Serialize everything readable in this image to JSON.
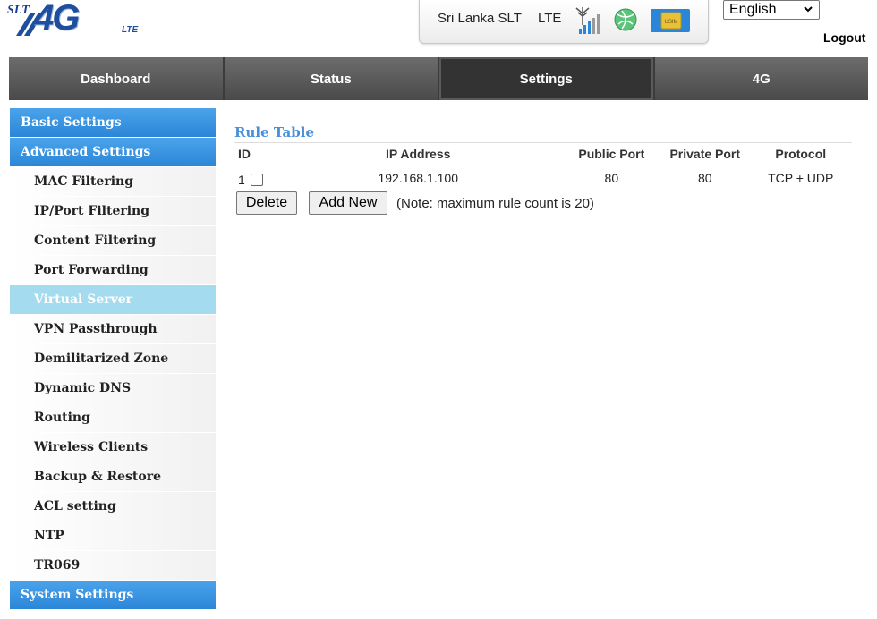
{
  "header": {
    "logo": {
      "brand": "SLT",
      "product": "4G",
      "suffix": "LTE"
    },
    "status": {
      "operator": "Sri Lanka SLT",
      "network_type": "LTE",
      "sim_label": "USIM"
    },
    "language": {
      "selected": "English"
    },
    "logout_label": "Logout"
  },
  "topnav": {
    "tabs": [
      {
        "label": "Dashboard"
      },
      {
        "label": "Status"
      },
      {
        "label": "Settings"
      },
      {
        "label": "4G"
      }
    ],
    "active_index": 2
  },
  "sidebar": {
    "basic_settings": "Basic Settings",
    "advanced_settings": "Advanced Settings",
    "items": [
      {
        "label": "MAC Filtering"
      },
      {
        "label": "IP/Port Filtering"
      },
      {
        "label": "Content Filtering"
      },
      {
        "label": "Port Forwarding"
      },
      {
        "label": "Virtual Server"
      },
      {
        "label": "VPN Passthrough"
      },
      {
        "label": "Demilitarized Zone"
      },
      {
        "label": "Dynamic DNS"
      },
      {
        "label": "Routing"
      },
      {
        "label": "Wireless Clients"
      },
      {
        "label": "Backup & Restore"
      },
      {
        "label": "ACL setting"
      },
      {
        "label": "NTP"
      },
      {
        "label": "TR069"
      }
    ],
    "active_item": "Virtual Server",
    "system_settings": "System Settings"
  },
  "main": {
    "title": "Rule Table",
    "columns": {
      "id": "ID",
      "ip": "IP Address",
      "public_port": "Public Port",
      "private_port": "Private Port",
      "protocol": "Protocol"
    },
    "rows": [
      {
        "id": "1",
        "ip": "192.168.1.100",
        "public_port": "80",
        "private_port": "80",
        "protocol": "TCP + UDP",
        "checked": false
      }
    ],
    "delete_label": "Delete",
    "add_new_label": "Add New",
    "note": "(Note: maximum rule count is 20)"
  },
  "colors": {
    "sidebar_header": "#2c86d8",
    "sidebar_active": "#a4dbee",
    "nav_bg": "#555555",
    "title_color": "#4a90d9"
  }
}
